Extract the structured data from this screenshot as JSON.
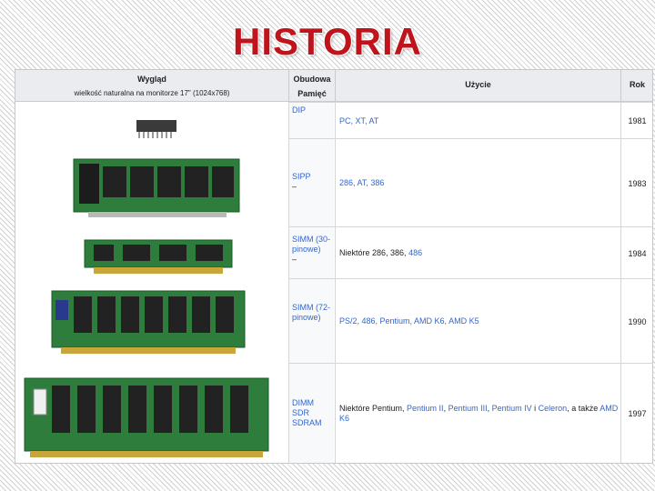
{
  "slide": {
    "title": "HISTORIA"
  },
  "table": {
    "headers": {
      "look": "Wygląd",
      "look_sub": "wielkość naturalna na monitorze 17\" (1024x768)",
      "case_line1": "Obudowa",
      "case_line2": "Pamięć",
      "use": "Użycie",
      "year": "Rok"
    },
    "rows": [
      {
        "case_lines": [
          "DIP"
        ],
        "use_parts": [
          "PC, XT, AT"
        ],
        "year": "1981"
      },
      {
        "case_lines": [
          "SIPP",
          "–"
        ],
        "use_parts": [
          "286, AT, 386"
        ],
        "year": "1983"
      },
      {
        "case_lines": [
          "SIMM (30-",
          "pinowe)",
          "–"
        ],
        "use_parts": [
          "Niektóre 286, 386, ",
          "486"
        ],
        "year": "1984"
      },
      {
        "case_lines": [
          "SIMM (72-",
          "pinowe)"
        ],
        "use_parts": [
          "PS/2, 486, Pentium, AMD K6, AMD K5"
        ],
        "year": "1990"
      },
      {
        "case_lines": [
          "DIMM",
          "SDR",
          "SDRAM"
        ],
        "use_parts": [
          "Niektóre Pentium, ",
          "Pentium II",
          ", ",
          "Pentium III",
          ", ",
          "Pentium IV",
          " i ",
          "Celeron",
          ", a także ",
          "AMD K6"
        ],
        "year": "1997"
      }
    ]
  },
  "colors": {
    "title": "#c0141c",
    "link": "#3366cc",
    "header_bg": "#eaecf0",
    "pcb_green": "#2e7d3c"
  }
}
